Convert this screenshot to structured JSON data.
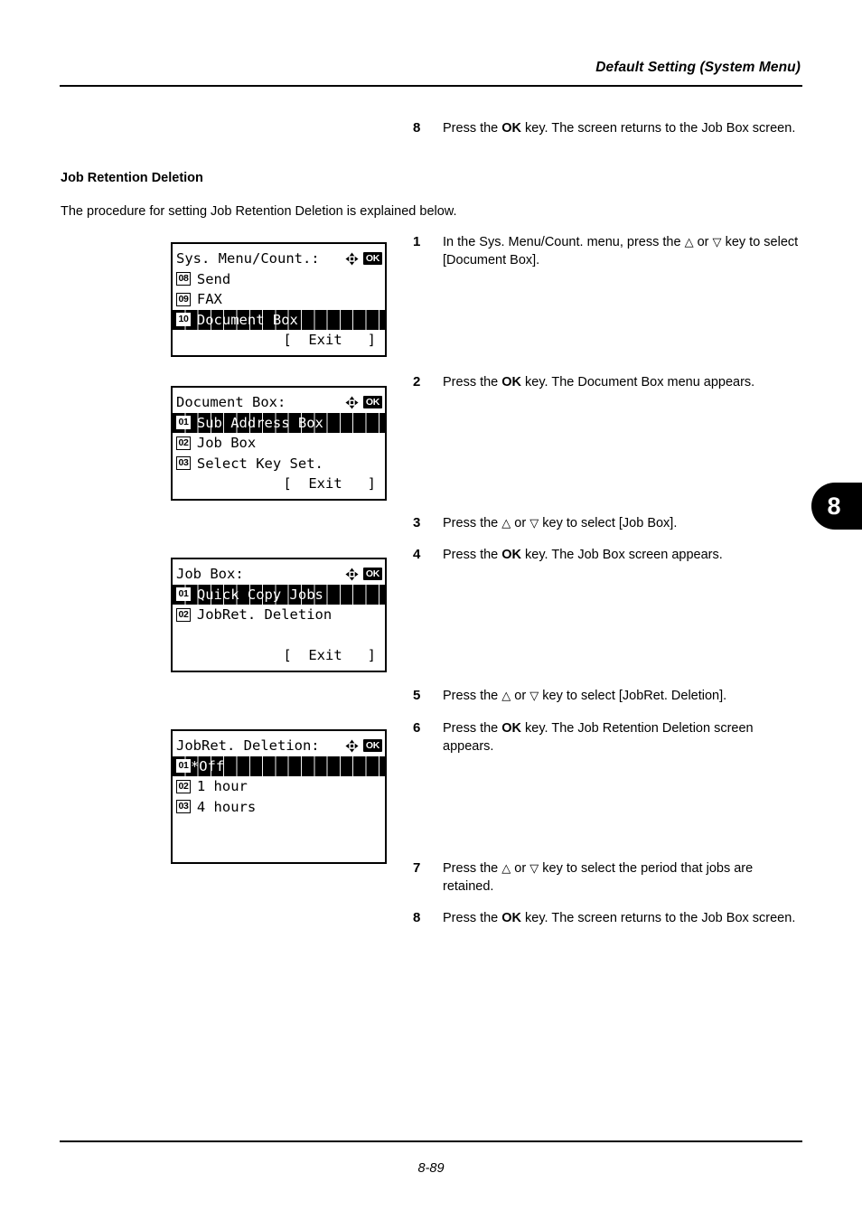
{
  "header": {
    "title": "Default Setting (System Menu)"
  },
  "footer": {
    "page_number": "8-89"
  },
  "chapter_tab": {
    "number": "8"
  },
  "section": {
    "heading": "Job Retention Deletion",
    "intro": "The procedure for setting Job Retention Deletion is explained below."
  },
  "top_step": {
    "number": "8",
    "text_before": "Press the ",
    "key": "OK",
    "text_after": " key. The screen returns to the Job Box screen."
  },
  "steps": [
    {
      "number": "1",
      "parts": [
        {
          "t": "In the Sys. Menu/Count. menu, press the "
        },
        {
          "t": "△",
          "icon": "up-arrow-key-icon"
        },
        {
          "t": " or "
        },
        {
          "t": "▽",
          "icon": "down-arrow-key-icon"
        },
        {
          "t": " key to select [Document Box]."
        }
      ],
      "plain": "In the Sys. Menu/Count. menu, press the △ or ▽ key to select [Document Box]."
    },
    {
      "number": "2",
      "plain": "Press the OK key. The Document Box menu appears.",
      "pre": "Press the ",
      "bold": "OK",
      "post": " key. The Document Box menu appears."
    },
    {
      "number": "3",
      "plain": "Press the △ or ▽ key to select [Job Box]."
    },
    {
      "number": "4",
      "plain": "Press the OK key. The Job Box screen appears.",
      "pre": "Press the ",
      "bold": "OK",
      "post": " key. The Job Box screen appears."
    },
    {
      "number": "5",
      "plain": "Press the △ or ▽ key to select [JobRet. Deletion]."
    },
    {
      "number": "6",
      "plain": "Press the OK key. The Job Retention Deletion screen appears.",
      "pre": "Press the ",
      "bold": "OK",
      "post": " key. The Job Retention Deletion screen appears."
    },
    {
      "number": "7",
      "plain": "Press the △ or ▽ key to select the period that jobs are retained."
    },
    {
      "number": "8",
      "plain": "Press the OK key. The screen returns to the Job Box screen.",
      "pre": "Press the ",
      "bold": "OK",
      "post": " key. The screen returns to the Job Box screen."
    }
  ],
  "labels": {
    "ok_key": "OK",
    "exit": "[  Exit   ]",
    "press_the": "Press the ",
    "or": " or ",
    "key_to_select": " key to select "
  },
  "screens": [
    {
      "name": "sys-menu-count",
      "title": "Sys. Menu/Count.:",
      "items": [
        {
          "num": "08",
          "label": "Send",
          "selected": false
        },
        {
          "num": "09",
          "label": "FAX",
          "selected": false
        },
        {
          "num": "10",
          "label": "Document Box",
          "selected": true
        }
      ],
      "blank_rows": 0,
      "exit": "[  Exit   ]",
      "has_exit": true
    },
    {
      "name": "document-box",
      "title": "Document Box:",
      "items": [
        {
          "num": "01",
          "label": "Sub Address Box",
          "selected": true
        },
        {
          "num": "02",
          "label": "Job Box",
          "selected": false
        },
        {
          "num": "03",
          "label": "Select Key Set.",
          "selected": false
        }
      ],
      "blank_rows": 0,
      "exit": "[  Exit   ]",
      "has_exit": true
    },
    {
      "name": "job-box",
      "title": "Job Box:",
      "items": [
        {
          "num": "01",
          "label": "Quick Copy Jobs",
          "selected": true
        },
        {
          "num": "02",
          "label": "JobRet. Deletion",
          "selected": false
        }
      ],
      "blank_rows": 1,
      "exit": "[  Exit   ]",
      "has_exit": true
    },
    {
      "name": "jobret-deletion",
      "title": "JobRet. Deletion:",
      "items": [
        {
          "num": "01",
          "label": "*Off",
          "selected": true,
          "tight": true
        },
        {
          "num": "02",
          "label": "1 hour",
          "selected": false
        },
        {
          "num": "03",
          "label": "4 hours",
          "selected": false
        }
      ],
      "blank_rows": 1,
      "exit": "",
      "has_exit": false
    }
  ],
  "icons": {
    "dpad": "four-direction-arrow-cluster-icon",
    "ok_badge": "ok-key-badge-icon"
  }
}
